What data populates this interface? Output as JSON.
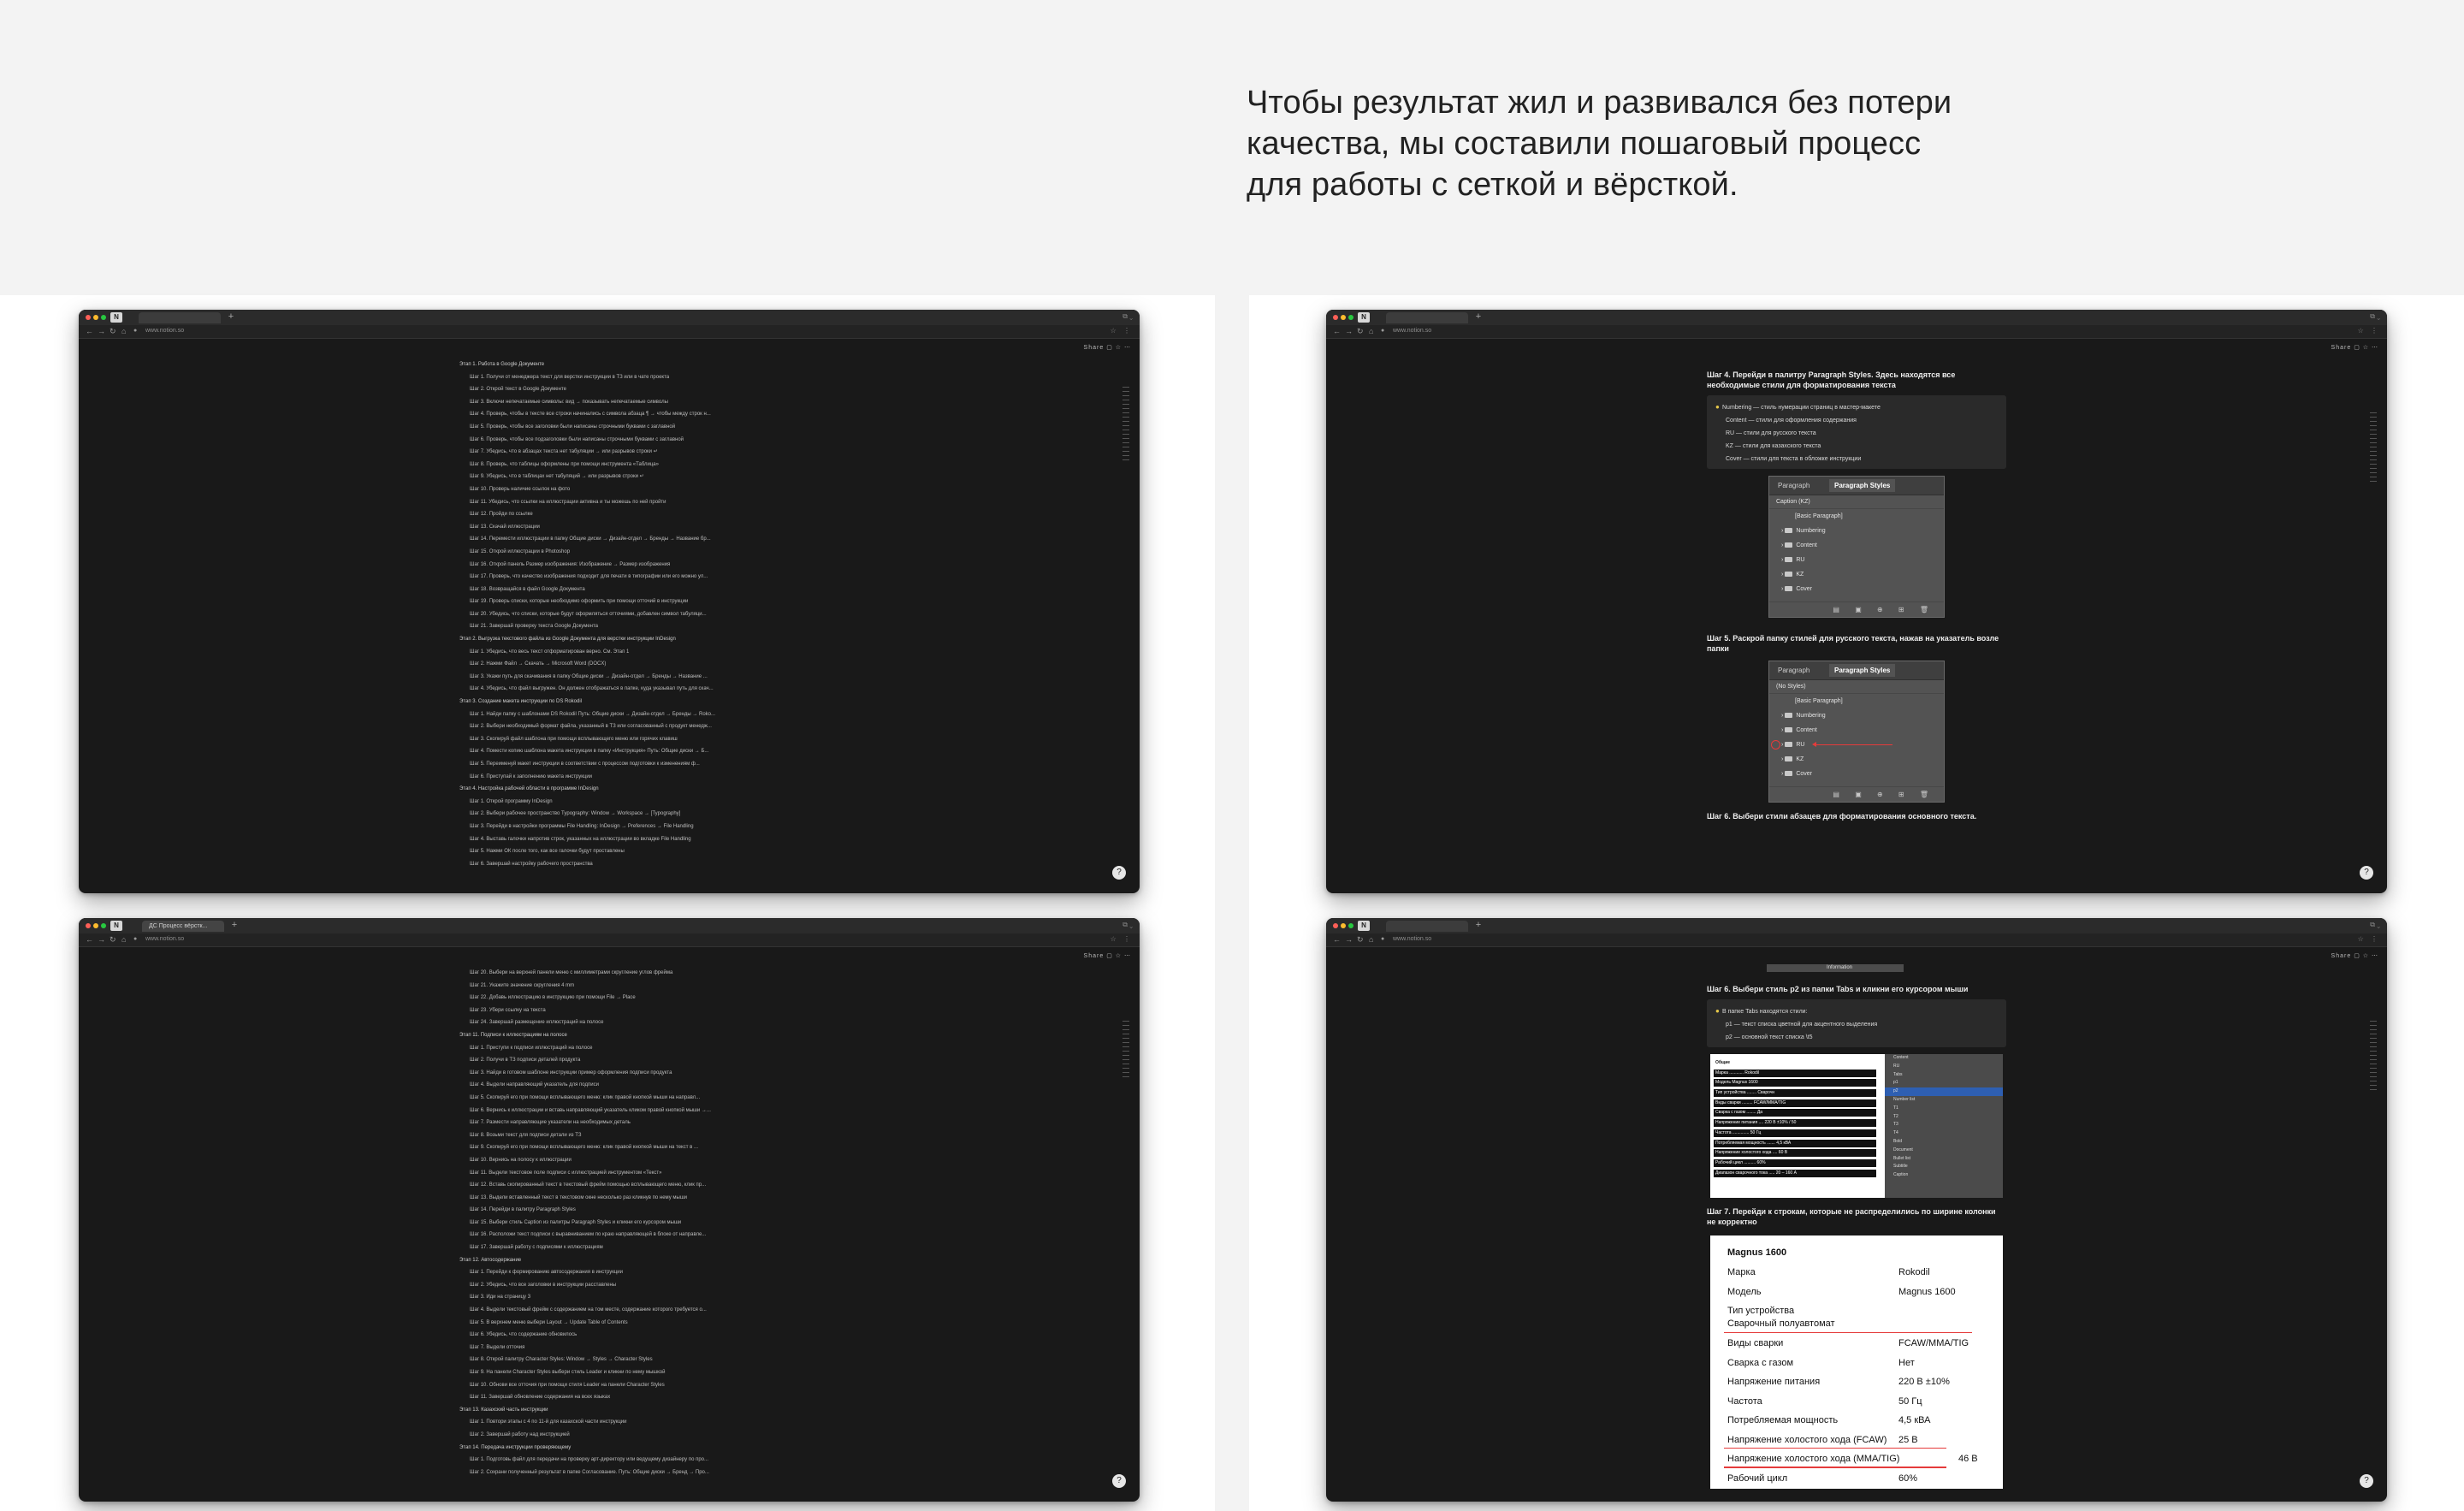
{
  "intro": {
    "lines": [
      "Чтобы результат жил и развивался без потери",
      "качества, мы составили пошаговый процесс",
      "для работы с сеткой и вёрсткой."
    ]
  },
  "browser": {
    "url": "www.notion.so",
    "app_icon": "notion-icon",
    "notion_actions": "Share",
    "help": "?"
  },
  "window1": {
    "lines": [
      {
        "kind": "stage",
        "text": "Этап 1. Работа в Google Документе"
      },
      {
        "kind": "step",
        "text": "Шаг 1. Получи от менеджера текст для верстки инструкции в ТЗ или в чате проекта"
      },
      {
        "kind": "step",
        "text": "Шаг 2. Открой текст в Google Документе"
      },
      {
        "kind": "step",
        "text": "Шаг 3. Включи непечатаемые символы: вид → показывать непечатаемые символы"
      },
      {
        "kind": "step",
        "text": "Шаг 4. Проверь, чтобы в тексте все строки начинались с символа абзаца ¶ → чтобы между строк н..."
      },
      {
        "kind": "step",
        "text": "Шаг 5. Проверь, чтобы все заголовки были написаны строчными буквами с заглавной"
      },
      {
        "kind": "step",
        "text": "Шаг 6. Проверь, чтобы все подзаголовки были написаны строчными буквами с заглавной"
      },
      {
        "kind": "step",
        "text": "Шаг 7. Убедись, что в абзацах текста нет табуляции → или разрывов строки ↵"
      },
      {
        "kind": "step",
        "text": "Шаг 8. Проверь, что таблицы оформлены при помощи инструмента «Таблица»"
      },
      {
        "kind": "step",
        "text": "Шаг 9. Убедись, что в таблицах нет табуляций → или разрывов строки ↵"
      },
      {
        "kind": "step",
        "text": "Шаг 10. Проверь наличие ссылок на фото"
      },
      {
        "kind": "step",
        "text": "Шаг 11. Убедись, что ссылки на иллюстрации активна и ты можешь по ней пройти"
      },
      {
        "kind": "step",
        "text": "Шаг 12. Пройди по ссылке"
      },
      {
        "kind": "step",
        "text": "Шаг 13. Скачай иллюстрации"
      },
      {
        "kind": "step",
        "text": "Шаг 14. Перемести иллюстрации в папку Общие диски → Дизайн-отдел → Бренды → Название бр..."
      },
      {
        "kind": "step",
        "text": "Шаг 15. Открой иллюстрации в Photoshop"
      },
      {
        "kind": "step",
        "text": "Шаг 16. Открой панель Размер изображения: Изображение → Размер изображения"
      },
      {
        "kind": "step",
        "text": "Шаг 17. Проверь, что качество изображения подходит для печати в типографии или его можно ул..."
      },
      {
        "kind": "step",
        "text": "Шаг 18. Возвращайся в файл Google Документа"
      },
      {
        "kind": "step",
        "text": "Шаг 19. Проверь списки, которые необходимо оформить при помощи отточий в инструкции"
      },
      {
        "kind": "step",
        "text": "Шаг 20. Убедись, что списки, которые будут оформляться отточиями, добавлен символ табуляци..."
      },
      {
        "kind": "step",
        "text": "Шаг 21. Завершай проверку текста Google Документа"
      },
      {
        "kind": "stage",
        "text": "Этап 2. Выгрузка текстового файла из Google Документа для верстки инструкции InDesign"
      },
      {
        "kind": "step",
        "text": "Шаг 1. Убедись, что весь текст отформатирован верно. См. Этап 1"
      },
      {
        "kind": "step",
        "text": "Шаг 2. Нажми Файл → Скачать → Microsoft Word (DOCX)"
      },
      {
        "kind": "step",
        "text": "Шаг 3. Укажи путь для скачивания в папку Общие диски → Дизайн-отдел → Бренды → Название ..."
      },
      {
        "kind": "step",
        "text": "Шаг 4. Убедись, что файл выгружен. Он должен отображаться в папке, куда указывал путь для скач..."
      },
      {
        "kind": "stage",
        "text": "Этап 3. Создание макета инструкции по DS Rokodil"
      },
      {
        "kind": "step",
        "text": "Шаг 1. Найди папку с шаблонами DS Rokodil Путь: Общие диски → Дизайн-отдел → Бренды → Roko..."
      },
      {
        "kind": "step",
        "text": "Шаг 2. Выбери необходимый формат файла, указанный в ТЗ или согласованный с продукт менедж..."
      },
      {
        "kind": "step",
        "text": "Шаг 3. Скопируй файл шаблона при помощи всплывающего меню или горячих клавиш"
      },
      {
        "kind": "step",
        "text": "Шаг 4. Помести копию шаблона макета инструкции в папку «Инструкция» Путь: Общие диски → Б..."
      },
      {
        "kind": "step",
        "text": "Шаг 5. Переименуй макет инструкции в соответствии с процессом подготовки к изменениям ф..."
      },
      {
        "kind": "step",
        "text": "Шаг 6. Приступай к заполнению макета инструкции"
      },
      {
        "kind": "stage",
        "text": "Этап 4. Настройка рабочей области в программе InDesign"
      },
      {
        "kind": "step",
        "text": "Шаг 1. Открой программу InDesign"
      },
      {
        "kind": "step",
        "text": "Шаг 2. Выбери рабочее пространство Typography: Window → Workspace → [Typography]"
      },
      {
        "kind": "step",
        "text": "Шаг 3. Перейди в настройки программы File Handling: InDesign → Preferences → File Handling"
      },
      {
        "kind": "step",
        "text": "Шаг 4. Выставь галочки напротив строк, указанных на иллюстрации во вкладке File Handling"
      },
      {
        "kind": "step",
        "text": "Шаг 5. Нажми ОК после того, как все галочки будут проставлены"
      },
      {
        "kind": "step",
        "text": "Шаг 6. Завершай настройку рабочего пространства"
      }
    ]
  },
  "window3": {
    "tab_label": "ДС Процесс вёрстк...",
    "lines": [
      {
        "kind": "step",
        "text": "Шаг 20. Выбери на верхней панели меню с миллиметрами скругление углов фрейма"
      },
      {
        "kind": "step",
        "text": "Шаг 21. Укажите значение скругления 4 mm"
      },
      {
        "kind": "step",
        "text": "Шаг 22. Добавь иллюстрацию в инструкцию при помощи File → Place"
      },
      {
        "kind": "step",
        "text": "Шаг 23. Убери ссылку на текста"
      },
      {
        "kind": "step",
        "text": "Шаг 24. Завершай размещение иллюстраций на полосе"
      },
      {
        "kind": "stage",
        "text": "Этап 11. Подписи к иллюстрациям на полосе"
      },
      {
        "kind": "step",
        "text": "Шаг 1. Приступи к подписи иллюстраций на полосе"
      },
      {
        "kind": "step",
        "text": "Шаг 2. Получи в ТЗ подписи деталей продукта"
      },
      {
        "kind": "step",
        "text": "Шаг 3. Найди в готовом шаблоне инструкции пример оформления подписи продукта"
      },
      {
        "kind": "step",
        "text": "Шаг 4. Выдели направляющий указатель для подписи"
      },
      {
        "kind": "step",
        "text": "Шаг 5. Скопируй его при помощи всплывающего меню: клик правой кнопкой мыши на направл..."
      },
      {
        "kind": "step",
        "text": "Шаг 6. Вернись к иллюстрации и вставь направляющий указатель кликом правой кнопкой мыши →..."
      },
      {
        "kind": "step",
        "text": "Шаг 7. Размести направляющие указатели на необходимых деталь"
      },
      {
        "kind": "step",
        "text": "Шаг 8. Возьми текст для подписи детали из ТЗ"
      },
      {
        "kind": "step",
        "text": "Шаг 9. Скопируй его при помощи всплывающего меню: клик правой кнопкой мыши на текст в ..."
      },
      {
        "kind": "step",
        "text": "Шаг 10. Вернись на полосу к иллюстрации"
      },
      {
        "kind": "step",
        "text": "Шаг 11. Выдели текстовое поле подписи с иллюстрацией инструментом «Текст»"
      },
      {
        "kind": "step",
        "text": "Шаг 12. Вставь скопированный текст в текстовый фрейм помощью всплывающего меню, клик пр..."
      },
      {
        "kind": "step",
        "text": "Шаг 13. Выдели вставленный текст в текстовом окне несколько раз кликнув по нему мыши"
      },
      {
        "kind": "step",
        "text": "Шаг 14. Перейди в палитру Paragraph Styles"
      },
      {
        "kind": "step",
        "text": "Шаг 15. Выбери стиль Caption из палитры Paragraph Styles и кликни его курсором мыши"
      },
      {
        "kind": "step",
        "text": "Шаг 16. Расположи текст подписи с выравниванием по краю направляющей в блоке от направле..."
      },
      {
        "kind": "step",
        "text": "Шаг 17. Завершай работу с подписями к иллюстрациям"
      },
      {
        "kind": "stage",
        "text": "Этап 12. Автосодержание"
      },
      {
        "kind": "step",
        "text": "Шаг 1. Перейди к формированию автосодержания в инструкции"
      },
      {
        "kind": "step",
        "text": "Шаг 2. Убедись, что все заголовки в инструкции расставлены"
      },
      {
        "kind": "step",
        "text": "Шаг 3. Иди на страницу 3"
      },
      {
        "kind": "step",
        "text": "Шаг 4. Выдели текстовый фрейм с содержанием на том месте, содержание которого требуется о..."
      },
      {
        "kind": "step",
        "text": "Шаг 5. В верхнем меню выбери Layout → Update Table of Contents"
      },
      {
        "kind": "step",
        "text": "Шаг 6. Убедись, что содержание обновилось"
      },
      {
        "kind": "step",
        "text": "Шаг 7. Выдели отточия"
      },
      {
        "kind": "step",
        "text": "Шаг 8. Открой палитру Character Styles: Window → Styles → Character Styles"
      },
      {
        "kind": "step",
        "text": "Шаг 9. На панели Character Styles выбери стиль Leader и кликни по нему мышкой"
      },
      {
        "kind": "step",
        "text": "Шаг 10. Обнови все отточия при помощи стиля Leader на панели Character Styles"
      },
      {
        "kind": "step",
        "text": "Шаг 11. Завершай обновление содержания на всех языках"
      },
      {
        "kind": "stage",
        "text": "Этап 13. Казахский часть инструкции"
      },
      {
        "kind": "step",
        "text": "Шаг 1. Повтори этапы с 4 по 11-й для казахской части инструкции"
      },
      {
        "kind": "step",
        "text": "Шаг 2. Завершай работу над инструкцией"
      },
      {
        "kind": "stage",
        "text": "Этап 14. Передача инструкции проверяющему"
      },
      {
        "kind": "step",
        "text": "Шаг 1. Подготовь файл для передачи на проверку арт-директору или ведущему дизайнеру по про..."
      },
      {
        "kind": "step",
        "text": "Шаг 2. Сохрани полученный результат в папке Согласование. Путь: Общие диски → Бренд → Про..."
      }
    ]
  },
  "window2": {
    "step4_title": "Шаг 4. Перейди в палитру Paragraph Styles. Здесь находятся все необходимые стили для форматирования текста",
    "callout": [
      "Numbering — стиль нумерации страниц в мастер-макете",
      "Content — стили для оформления содержания",
      "RU — стили для русского текста",
      "KZ — стили для казахского текста",
      "Cover — стили для текста в обложке инструкции"
    ],
    "panel1": {
      "tab_paragraph": "Paragraph",
      "tab_styles": "Paragraph Styles",
      "current": "Caption (KZ)",
      "basic": "[Basic Paragraph]",
      "groups": [
        "Numbering",
        "Content",
        "RU",
        "KZ",
        "Cover"
      ]
    },
    "step5_title": "Шаг 5. Раскрой папку стилей для русского текста, нажав на указатель возле папки",
    "panel2": {
      "tab_paragraph": "Paragraph",
      "tab_styles": "Paragraph Styles",
      "current": "(No Styles)",
      "basic": "[Basic Paragraph]",
      "groups": [
        "Numbering",
        "Content",
        "RU",
        "KZ",
        "Cover"
      ]
    },
    "step6_title": "Шаг 6. Выбери стили абзацев для форматирования основного текста."
  },
  "window4": {
    "top_crop": "Information",
    "step6_title": "Шаг 6. Выбери стиль p2 из папки Tabs и кликни его курсором мыши",
    "callout": [
      "В папке Tabs находятся стили:",
      "p1 — текст списка цветной для акцентного выделения",
      "p2 — основной текст списка \\t5"
    ],
    "split_left": [
      "Общие",
      "Марка ............ Rokodil",
      "Модель Magnus 1600",
      "Тип устройства ........ Сварочн",
      "Виды сварки ......... FCAW/MMA/TIG",
      "Сварка с газом ........ Да",
      "Напряжение питания .... 220 В ±10% / 50",
      "Частота .............. 50 Гц",
      "Потребляемая мощность ....... 4,5 кВА",
      "Напряжение холостого хода .... 60 В",
      "Рабочий цикл .......... 60%",
      "Диапазон сварочного тока ..... 20 – 160 А"
    ],
    "split_right": [
      "Content",
      "RU",
      "Tabs",
      "p1",
      "p2",
      "Number list",
      "T1",
      "T2",
      "T3",
      "T4",
      "Bold",
      "Document",
      "Bullet list",
      "Subtitle",
      "Caption"
    ],
    "step7_title": "Шаг 7. Перейди к строкам, которые не распределились по ширине колонки не корректно",
    "table": {
      "title": "Magnus 1600",
      "rows": [
        {
          "k": "Марка",
          "v": "Rokodil"
        },
        {
          "k": "Модель",
          "v": "Magnus 1600"
        },
        {
          "k": "Тип устройства\nСварочный полуавтомат",
          "v": ""
        },
        {
          "k": "Виды сварки",
          "v": "FCAW/MMA/TIG"
        },
        {
          "k": "Сварка с газом",
          "v": "Нет"
        },
        {
          "k": "Напряжение питания",
          "v": "220 В ±10%"
        },
        {
          "k": "Частота",
          "v": "50 Гц"
        },
        {
          "k": "Потребляемая мощность",
          "v": "4,5 кВА"
        },
        {
          "k": "Напряжение холостого хода (FCAW)",
          "v": "25 В"
        },
        {
          "k": "Напряжение холостого хода (MMA/TIG)",
          "v": "46 В"
        },
        {
          "k": "Рабочий цикл",
          "v": "60%"
        }
      ]
    }
  }
}
